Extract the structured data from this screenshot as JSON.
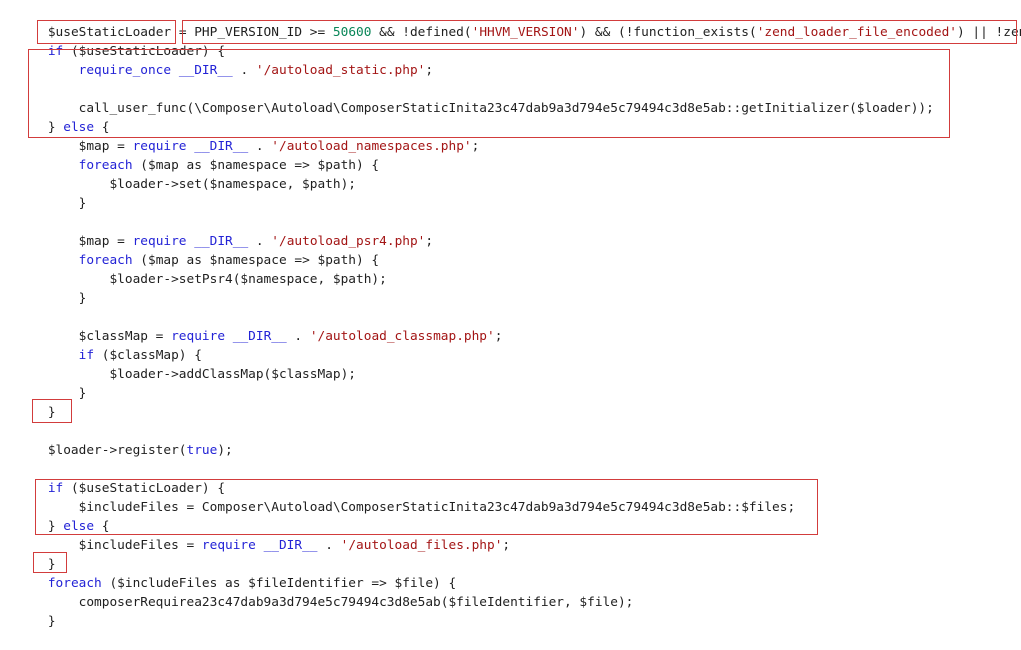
{
  "code_lines": [
    {
      "tokens": [
        {
          "t": "plain",
          "v": "    "
        },
        {
          "t": "plain",
          "v": "$useStaticLoader"
        },
        {
          "t": "plain",
          "v": " = PHP_VERSION_ID >= "
        },
        {
          "t": "num",
          "v": "50600"
        },
        {
          "t": "plain",
          "v": " && !defined("
        },
        {
          "t": "str",
          "v": "'HHVM_VERSION'"
        },
        {
          "t": "plain",
          "v": ") && (!function_exists("
        },
        {
          "t": "str",
          "v": "'zend_loader_file_encoded'"
        },
        {
          "t": "plain",
          "v": ") || !zend"
        }
      ]
    },
    {
      "tokens": [
        {
          "t": "plain",
          "v": "    "
        },
        {
          "t": "kw",
          "v": "if"
        },
        {
          "t": "plain",
          "v": " ($useStaticLoader) {"
        }
      ]
    },
    {
      "tokens": [
        {
          "t": "plain",
          "v": "        "
        },
        {
          "t": "kw",
          "v": "require_once"
        },
        {
          "t": "plain",
          "v": " "
        },
        {
          "t": "kw",
          "v": "__DIR__"
        },
        {
          "t": "plain",
          "v": " . "
        },
        {
          "t": "str",
          "v": "'/autoload_static.php'"
        },
        {
          "t": "plain",
          "v": ";"
        }
      ]
    },
    {
      "tokens": []
    },
    {
      "tokens": [
        {
          "t": "plain",
          "v": "        call_user_func(\\Composer\\Autoload\\ComposerStaticInita23c47dab9a3d794e5c79494c3d8e5ab::getInitializer($loader));"
        }
      ]
    },
    {
      "tokens": [
        {
          "t": "plain",
          "v": "    } "
        },
        {
          "t": "kw",
          "v": "else"
        },
        {
          "t": "plain",
          "v": " {"
        }
      ]
    },
    {
      "tokens": [
        {
          "t": "plain",
          "v": "        $map = "
        },
        {
          "t": "kw",
          "v": "require"
        },
        {
          "t": "plain",
          "v": " "
        },
        {
          "t": "kw",
          "v": "__DIR__"
        },
        {
          "t": "plain",
          "v": " . "
        },
        {
          "t": "str",
          "v": "'/autoload_namespaces.php'"
        },
        {
          "t": "plain",
          "v": ";"
        }
      ]
    },
    {
      "tokens": [
        {
          "t": "plain",
          "v": "        "
        },
        {
          "t": "kw",
          "v": "foreach"
        },
        {
          "t": "plain",
          "v": " ($map as $namespace => $path) {"
        }
      ]
    },
    {
      "tokens": [
        {
          "t": "plain",
          "v": "            $loader->set($namespace, $path);"
        }
      ]
    },
    {
      "tokens": [
        {
          "t": "plain",
          "v": "        }"
        }
      ]
    },
    {
      "tokens": []
    },
    {
      "tokens": [
        {
          "t": "plain",
          "v": "        $map = "
        },
        {
          "t": "kw",
          "v": "require"
        },
        {
          "t": "plain",
          "v": " "
        },
        {
          "t": "kw",
          "v": "__DIR__"
        },
        {
          "t": "plain",
          "v": " . "
        },
        {
          "t": "str",
          "v": "'/autoload_psr4.php'"
        },
        {
          "t": "plain",
          "v": ";"
        }
      ]
    },
    {
      "tokens": [
        {
          "t": "plain",
          "v": "        "
        },
        {
          "t": "kw",
          "v": "foreach"
        },
        {
          "t": "plain",
          "v": " ($map as $namespace => $path) {"
        }
      ]
    },
    {
      "tokens": [
        {
          "t": "plain",
          "v": "            $loader->setPsr4($namespace, $path);"
        }
      ]
    },
    {
      "tokens": [
        {
          "t": "plain",
          "v": "        }"
        }
      ]
    },
    {
      "tokens": []
    },
    {
      "tokens": [
        {
          "t": "plain",
          "v": "        $classMap = "
        },
        {
          "t": "kw",
          "v": "require"
        },
        {
          "t": "plain",
          "v": " "
        },
        {
          "t": "kw",
          "v": "__DIR__"
        },
        {
          "t": "plain",
          "v": " . "
        },
        {
          "t": "str",
          "v": "'/autoload_classmap.php'"
        },
        {
          "t": "plain",
          "v": ";"
        }
      ]
    },
    {
      "tokens": [
        {
          "t": "plain",
          "v": "        "
        },
        {
          "t": "kw",
          "v": "if"
        },
        {
          "t": "plain",
          "v": " ($classMap) {"
        }
      ]
    },
    {
      "tokens": [
        {
          "t": "plain",
          "v": "            $loader->addClassMap($classMap);"
        }
      ]
    },
    {
      "tokens": [
        {
          "t": "plain",
          "v": "        }"
        }
      ]
    },
    {
      "tokens": [
        {
          "t": "plain",
          "v": "    }"
        }
      ]
    },
    {
      "tokens": []
    },
    {
      "tokens": [
        {
          "t": "plain",
          "v": "    $loader->register("
        },
        {
          "t": "kw",
          "v": "true"
        },
        {
          "t": "plain",
          "v": ");"
        }
      ]
    },
    {
      "tokens": []
    },
    {
      "tokens": [
        {
          "t": "plain",
          "v": "    "
        },
        {
          "t": "kw",
          "v": "if"
        },
        {
          "t": "plain",
          "v": " ($useStaticLoader) {"
        }
      ]
    },
    {
      "tokens": [
        {
          "t": "plain",
          "v": "        $includeFiles = Composer\\Autoload\\ComposerStaticInita23c47dab9a3d794e5c79494c3d8e5ab::$files;"
        }
      ]
    },
    {
      "tokens": [
        {
          "t": "plain",
          "v": "    } "
        },
        {
          "t": "kw",
          "v": "else"
        },
        {
          "t": "plain",
          "v": " {"
        }
      ]
    },
    {
      "tokens": [
        {
          "t": "plain",
          "v": "        $includeFiles = "
        },
        {
          "t": "kw",
          "v": "require"
        },
        {
          "t": "plain",
          "v": " "
        },
        {
          "t": "kw",
          "v": "__DIR__"
        },
        {
          "t": "plain",
          "v": " . "
        },
        {
          "t": "str",
          "v": "'/autoload_files.php'"
        },
        {
          "t": "plain",
          "v": ";"
        }
      ]
    },
    {
      "tokens": [
        {
          "t": "plain",
          "v": "    }"
        }
      ]
    },
    {
      "tokens": [
        {
          "t": "plain",
          "v": "    "
        },
        {
          "t": "kw",
          "v": "foreach"
        },
        {
          "t": "plain",
          "v": " ($includeFiles as $fileIdentifier => $file) {"
        }
      ]
    },
    {
      "tokens": [
        {
          "t": "plain",
          "v": "        composerRequirea23c47dab9a3d794e5c79494c3d8e5ab($fileIdentifier, $file);"
        }
      ]
    },
    {
      "tokens": [
        {
          "t": "plain",
          "v": "    }"
        }
      ]
    }
  ],
  "colors": {
    "keyword": "#2323d6",
    "string": "#a31515",
    "number": "#098658",
    "text": "#1f1f1f",
    "highlight_box": "#d23c3c",
    "background": "#ffffff"
  }
}
